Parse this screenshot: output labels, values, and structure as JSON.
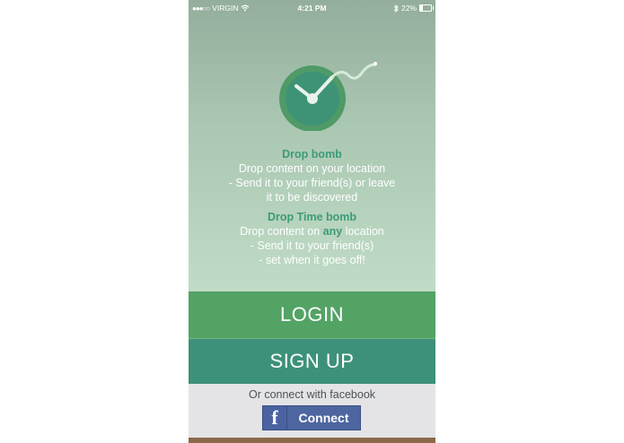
{
  "status_bar": {
    "signal": "●●●○○",
    "carrier": "VIRGIN",
    "wifi_icon": "wifi-icon",
    "time": "4:21 PM",
    "bluetooth_icon": "bluetooth-icon",
    "battery_percent": "22%",
    "battery_level": 0.22
  },
  "logo": {
    "icon": "bomb-clock-icon",
    "colors": {
      "outer": "#4f9a67",
      "inner": "#3e9377",
      "fuse": "#d4ecd8"
    }
  },
  "drop_bomb": {
    "title": "Drop bomb",
    "line1": "Drop content on your location",
    "line2": "- Send it to your friend(s) or leave",
    "line3": "it to be discovered"
  },
  "drop_time_bomb": {
    "title": "Drop Time bomb",
    "line1_pre": "Drop content on ",
    "line1_em": "any",
    "line1_post": " location",
    "line2": "- Send it to your friend(s)",
    "line3": "- set when it goes off!"
  },
  "buttons": {
    "login": "LOGIN",
    "signup": "SIGN UP"
  },
  "facebook": {
    "prompt": "Or connect with facebook",
    "icon": "f",
    "connect_label": "Connect"
  },
  "colors": {
    "accent_green": "#3d9b77",
    "login_bg": "#53a365",
    "signup_bg": "#3d917a",
    "facebook_blue": "#4d66a0"
  }
}
